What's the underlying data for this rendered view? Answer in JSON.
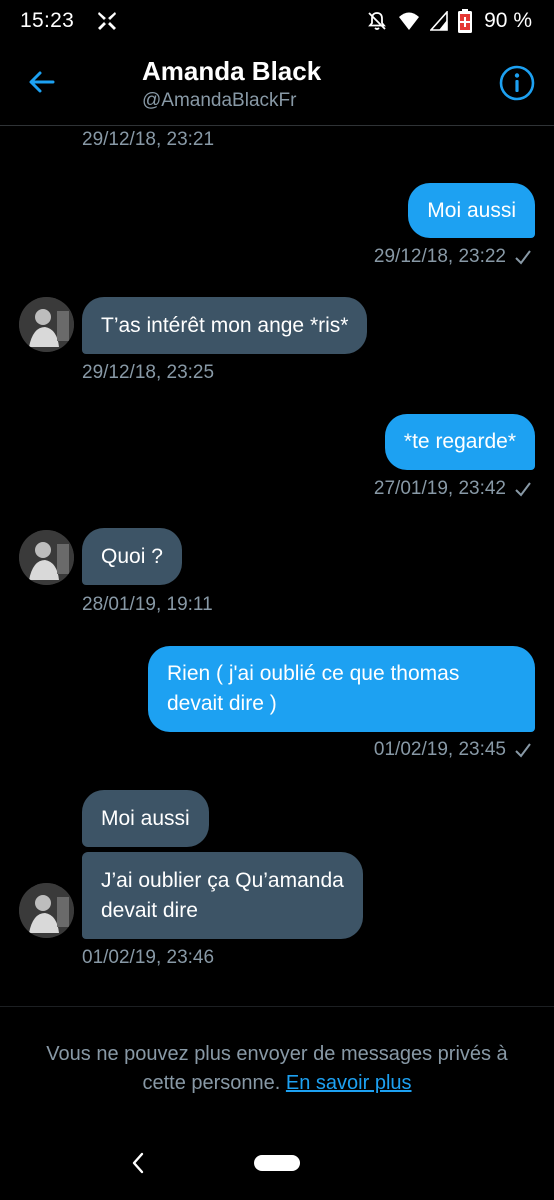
{
  "status_bar": {
    "time": "15:23",
    "battery": "90 %",
    "icons": [
      "app-icon",
      "bell-off-icon",
      "wifi-icon",
      "signal-icon",
      "battery-icon"
    ]
  },
  "header": {
    "name": "Amanda Black",
    "handle": "@AmandaBlackFr",
    "back_icon": "arrow-left-icon",
    "info_icon": "info-icon"
  },
  "messages": [
    {
      "direction": "in",
      "timestamp": "29/12/18, 23:21"
    },
    {
      "direction": "out",
      "text": "Moi aussi",
      "timestamp": "29/12/18, 23:22"
    },
    {
      "direction": "in",
      "text": "T’as intérêt mon ange *ris*",
      "timestamp": "29/12/18, 23:25"
    },
    {
      "direction": "out",
      "text": "*te regarde*",
      "timestamp": "27/01/19, 23:42"
    },
    {
      "direction": "in",
      "text": "Quoi ?",
      "timestamp": "28/01/19, 19:11"
    },
    {
      "direction": "out",
      "text_line1": "Rien  ( j'ai oublié ce que thomas",
      "text_line2": "devait dire )",
      "timestamp": "01/02/19, 23:45"
    },
    {
      "direction": "in",
      "text": "Moi aussi"
    },
    {
      "direction": "in",
      "text_line1": "J’ai oublier ça Qu’amanda",
      "text_line2": "devait dire",
      "timestamp": "01/02/19, 23:46"
    }
  ],
  "footer": {
    "notice_line1": "Vous ne pouvez plus envoyer de messages privés à",
    "notice_line2": "cette personne.",
    "link": "En savoir plus"
  },
  "colors": {
    "background": "#000000",
    "outgoing_bubble": "#1da1f2",
    "incoming_bubble": "#3d5466",
    "secondary_text": "#8899a6",
    "accent": "#1da1f2"
  }
}
